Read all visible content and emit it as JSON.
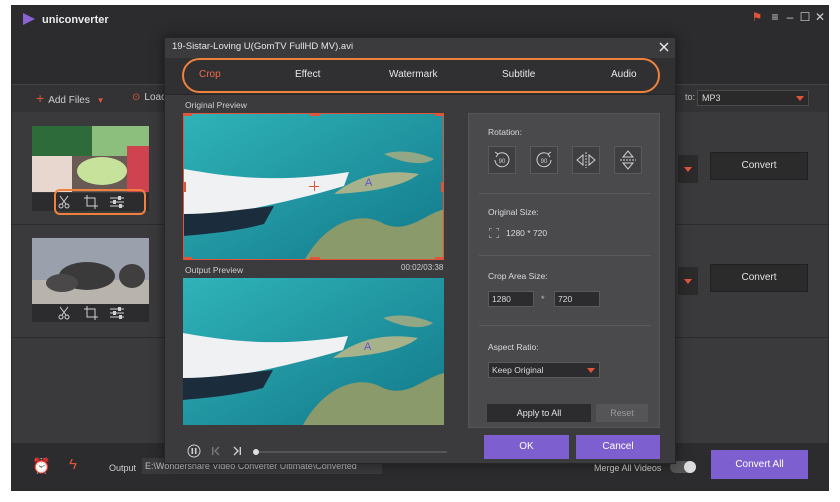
{
  "app": {
    "name": "uniconverter",
    "accent_color": "#7d5fd0",
    "highlight_color": "#f0813d",
    "icons": [
      "play-logo-icon",
      "gift-icon",
      "menu-icon",
      "minimize-icon",
      "maximize-icon",
      "close-icon"
    ]
  },
  "toolbar": {
    "add_files_label": "Add Files",
    "load_label": "Load",
    "format_prefix": "to:",
    "format_value": "MP3"
  },
  "files": [
    {
      "convert_label": "Convert"
    },
    {
      "convert_label": "Convert"
    }
  ],
  "bottom": {
    "output_label": "Output",
    "output_path": "E:\\Wondershare Video Converter Ultimate\\Converted",
    "merge_label": "Merge All Videos",
    "convert_all_label": "Convert All"
  },
  "dialog": {
    "title": "19-Sistar-Loving U(GomTV FullHD MV).avi",
    "tabs": [
      {
        "label": "Crop",
        "active": true
      },
      {
        "label": "Effect",
        "active": false
      },
      {
        "label": "Watermark",
        "active": false
      },
      {
        "label": "Subtitle",
        "active": false
      },
      {
        "label": "Audio",
        "active": false
      }
    ],
    "original_preview_label": "Original Preview",
    "output_preview_label": "Output Preview",
    "timestamp": "00:02/03:38",
    "rotation_label": "Rotation:",
    "original_size_label": "Original Size:",
    "original_size_value": "1280 * 720",
    "crop_area_label": "Crop Area Size:",
    "crop_width": "1280",
    "crop_times": "*",
    "crop_height": "720",
    "aspect_ratio_label": "Aspect Ratio:",
    "aspect_ratio_value": "Keep Original",
    "apply_all_label": "Apply to All",
    "reset_label": "Reset",
    "ok_label": "OK",
    "cancel_label": "Cancel",
    "rotate_labels": [
      "90",
      "90"
    ]
  }
}
